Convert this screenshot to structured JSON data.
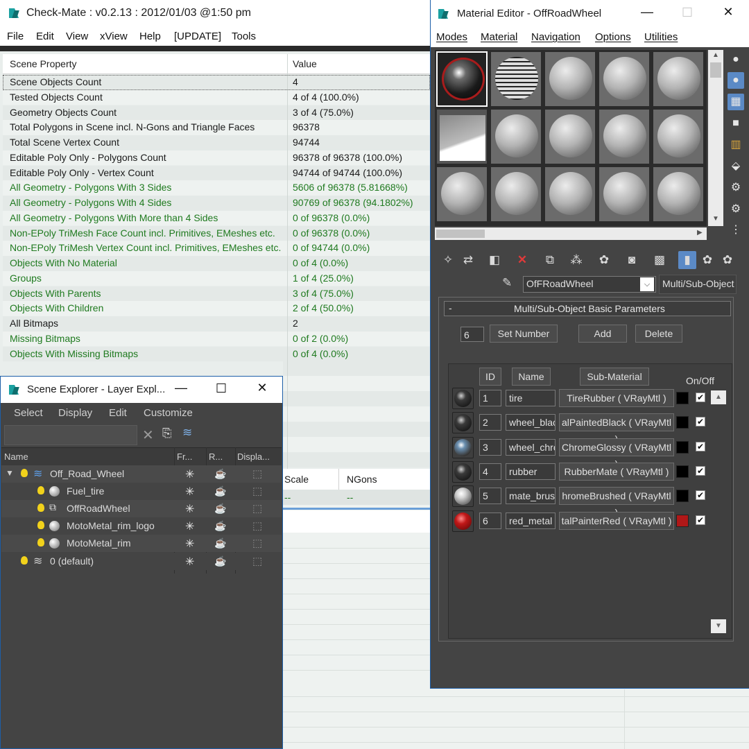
{
  "check_mate": {
    "title": "Check-Mate : v0.2.13 : 2012/01/03 @1:50 pm",
    "menu": [
      "File",
      "Edit",
      "View",
      "xView",
      "Help",
      "[UPDATE]",
      "Tools"
    ],
    "columns": [
      "Scene Property",
      "Value"
    ],
    "rows": [
      {
        "property": "Scene Objects Count",
        "value": "4"
      },
      {
        "property": "Tested Objects Count",
        "value": "4 of 4 (100.0%)"
      },
      {
        "property": "Geometry Objects Count",
        "value": "3 of 4 (75.0%)"
      },
      {
        "property": "Total Polygons in Scene incl. N-Gons and Triangle Faces",
        "value": "96378"
      },
      {
        "property": "Total Scene Vertex Count",
        "value": "94744"
      },
      {
        "property": "Editable Poly Only - Polygons Count",
        "value": "96378 of 96378 (100.0%)"
      },
      {
        "property": "Editable Poly Only - Vertex Count",
        "value": "94744 of 94744 (100.0%)"
      },
      {
        "property": "All Geometry - Polygons With 3 Sides",
        "value": "5606 of 96378 (5.81668%)"
      },
      {
        "property": "All Geometry - Polygons With 4 Sides",
        "value": "90769 of 96378 (94.1802%)"
      },
      {
        "property": "All Geometry - Polygons With More than 4 Sides",
        "value": "0 of 96378 (0.0%)"
      },
      {
        "property": "Non-EPoly TriMesh Face Count incl. Primitives, EMeshes etc.",
        "value": "0 of 96378 (0.0%)"
      },
      {
        "property": "Non-EPoly TriMesh Vertex Count incl. Primitives, EMeshes etc.",
        "value": "0 of 94744 (0.0%)"
      },
      {
        "property": "Objects With No Material",
        "value": "0 of 4 (0.0%)"
      },
      {
        "property": "Groups",
        "value": "1 of 4 (25.0%)"
      },
      {
        "property": "Objects With Parents",
        "value": "3 of 4 (75.0%)"
      },
      {
        "property": "Objects With Children",
        "value": "2 of 4 (50.0%)"
      },
      {
        "property": "All Bitmaps",
        "value": "2"
      },
      {
        "property": "Missing Bitmaps",
        "value": "0 of 2 (0.0%)"
      },
      {
        "property": "Objects With Missing Bitmaps",
        "value": "0 of 4 (0.0%)"
      }
    ],
    "lower_columns": [
      "Scale",
      "NGons"
    ],
    "lower_values": [
      "--",
      "--"
    ],
    "colors": {
      "green_text": "#1f7a1f"
    }
  },
  "scene_explorer": {
    "title": "Scene Explorer - Layer Expl...",
    "menu": [
      "Select",
      "Display",
      "Edit",
      "Customize"
    ],
    "columns": [
      "Name",
      "Fr...",
      "R...",
      "Displa..."
    ],
    "rows": [
      {
        "label": "Off_Road_Wheel",
        "icon": "layer-icon"
      },
      {
        "label": "Fuel_tire",
        "icon": "sphere-icon"
      },
      {
        "label": "OffRoadWheel",
        "icon": "group-icon"
      },
      {
        "label": "MotoMetal_rim_logo",
        "icon": "sphere-icon"
      },
      {
        "label": "MotoMetal_rim",
        "icon": "sphere-icon"
      },
      {
        "label": "0 (default)",
        "icon": "layer-icon"
      }
    ]
  },
  "material_editor": {
    "title": "Material Editor - OffRoadWheel",
    "menu": [
      "Modes",
      "Material",
      "Navigation",
      "Options",
      "Utilities"
    ],
    "material_name": "OfFRoadWheel",
    "material_type": "Multi/Sub-Object",
    "rollout_title": "Multi/Sub-Object Basic Parameters",
    "rollout_toggle": "-",
    "number_value": "6",
    "buttons": {
      "set_number": "Set Number",
      "add": "Add",
      "delete": "Delete"
    },
    "list_headers": {
      "id": "ID",
      "name": "Name",
      "sub_material": "Sub-Material",
      "on_off": "On/Off"
    },
    "sub_materials": [
      {
        "id": "1",
        "name": "tire",
        "sub_material": "TireRubber  ( VRayMtl )",
        "color": "#000000",
        "thumb": "dark"
      },
      {
        "id": "2",
        "name": "wheel_blac",
        "sub_material": "alPaintedBlack  ( VRayMtl )",
        "color": "#000000",
        "thumb": "dark"
      },
      {
        "id": "3",
        "name": "wheel_chro",
        "sub_material": "ChromeGlossy  ( VRayMtl )",
        "color": "#000000",
        "thumb": "noise"
      },
      {
        "id": "4",
        "name": "rubber",
        "sub_material": "RubberMate  ( VRayMtl )",
        "color": "#000000",
        "thumb": "dark"
      },
      {
        "id": "5",
        "name": "mate_brus",
        "sub_material": "hromeBrushed  ( VRayMtl )",
        "color": "#000000",
        "thumb": "chrome"
      },
      {
        "id": "6",
        "name": "red_metal",
        "sub_material": "talPainterRed  ( VRayMtl )",
        "color": "#b01818",
        "thumb": "red"
      }
    ]
  }
}
